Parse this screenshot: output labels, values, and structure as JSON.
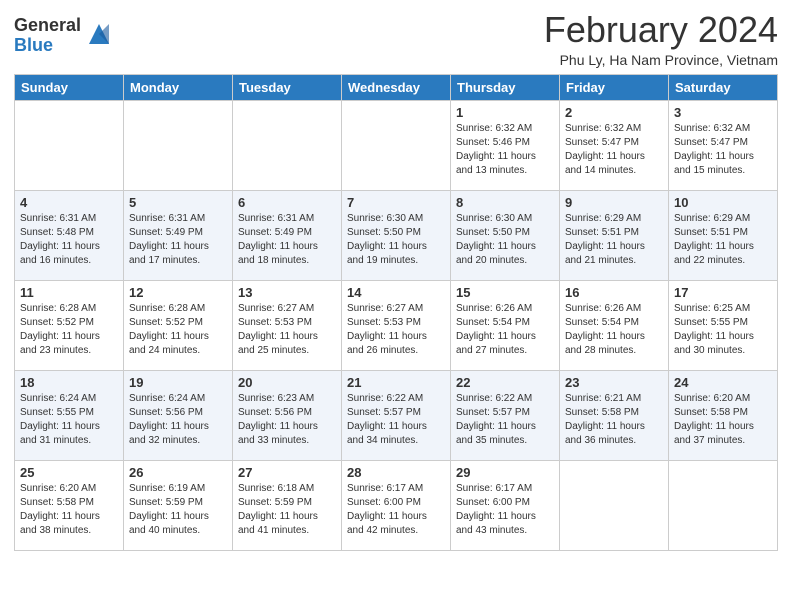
{
  "logo": {
    "general": "General",
    "blue": "Blue"
  },
  "title": "February 2024",
  "subtitle": "Phu Ly, Ha Nam Province, Vietnam",
  "days_of_week": [
    "Sunday",
    "Monday",
    "Tuesday",
    "Wednesday",
    "Thursday",
    "Friday",
    "Saturday"
  ],
  "weeks": [
    [
      {
        "day": "",
        "info": ""
      },
      {
        "day": "",
        "info": ""
      },
      {
        "day": "",
        "info": ""
      },
      {
        "day": "",
        "info": ""
      },
      {
        "day": "1",
        "info": "Sunrise: 6:32 AM\nSunset: 5:46 PM\nDaylight: 11 hours and 13 minutes."
      },
      {
        "day": "2",
        "info": "Sunrise: 6:32 AM\nSunset: 5:47 PM\nDaylight: 11 hours and 14 minutes."
      },
      {
        "day": "3",
        "info": "Sunrise: 6:32 AM\nSunset: 5:47 PM\nDaylight: 11 hours and 15 minutes."
      }
    ],
    [
      {
        "day": "4",
        "info": "Sunrise: 6:31 AM\nSunset: 5:48 PM\nDaylight: 11 hours and 16 minutes."
      },
      {
        "day": "5",
        "info": "Sunrise: 6:31 AM\nSunset: 5:49 PM\nDaylight: 11 hours and 17 minutes."
      },
      {
        "day": "6",
        "info": "Sunrise: 6:31 AM\nSunset: 5:49 PM\nDaylight: 11 hours and 18 minutes."
      },
      {
        "day": "7",
        "info": "Sunrise: 6:30 AM\nSunset: 5:50 PM\nDaylight: 11 hours and 19 minutes."
      },
      {
        "day": "8",
        "info": "Sunrise: 6:30 AM\nSunset: 5:50 PM\nDaylight: 11 hours and 20 minutes."
      },
      {
        "day": "9",
        "info": "Sunrise: 6:29 AM\nSunset: 5:51 PM\nDaylight: 11 hours and 21 minutes."
      },
      {
        "day": "10",
        "info": "Sunrise: 6:29 AM\nSunset: 5:51 PM\nDaylight: 11 hours and 22 minutes."
      }
    ],
    [
      {
        "day": "11",
        "info": "Sunrise: 6:28 AM\nSunset: 5:52 PM\nDaylight: 11 hours and 23 minutes."
      },
      {
        "day": "12",
        "info": "Sunrise: 6:28 AM\nSunset: 5:52 PM\nDaylight: 11 hours and 24 minutes."
      },
      {
        "day": "13",
        "info": "Sunrise: 6:27 AM\nSunset: 5:53 PM\nDaylight: 11 hours and 25 minutes."
      },
      {
        "day": "14",
        "info": "Sunrise: 6:27 AM\nSunset: 5:53 PM\nDaylight: 11 hours and 26 minutes."
      },
      {
        "day": "15",
        "info": "Sunrise: 6:26 AM\nSunset: 5:54 PM\nDaylight: 11 hours and 27 minutes."
      },
      {
        "day": "16",
        "info": "Sunrise: 6:26 AM\nSunset: 5:54 PM\nDaylight: 11 hours and 28 minutes."
      },
      {
        "day": "17",
        "info": "Sunrise: 6:25 AM\nSunset: 5:55 PM\nDaylight: 11 hours and 30 minutes."
      }
    ],
    [
      {
        "day": "18",
        "info": "Sunrise: 6:24 AM\nSunset: 5:55 PM\nDaylight: 11 hours and 31 minutes."
      },
      {
        "day": "19",
        "info": "Sunrise: 6:24 AM\nSunset: 5:56 PM\nDaylight: 11 hours and 32 minutes."
      },
      {
        "day": "20",
        "info": "Sunrise: 6:23 AM\nSunset: 5:56 PM\nDaylight: 11 hours and 33 minutes."
      },
      {
        "day": "21",
        "info": "Sunrise: 6:22 AM\nSunset: 5:57 PM\nDaylight: 11 hours and 34 minutes."
      },
      {
        "day": "22",
        "info": "Sunrise: 6:22 AM\nSunset: 5:57 PM\nDaylight: 11 hours and 35 minutes."
      },
      {
        "day": "23",
        "info": "Sunrise: 6:21 AM\nSunset: 5:58 PM\nDaylight: 11 hours and 36 minutes."
      },
      {
        "day": "24",
        "info": "Sunrise: 6:20 AM\nSunset: 5:58 PM\nDaylight: 11 hours and 37 minutes."
      }
    ],
    [
      {
        "day": "25",
        "info": "Sunrise: 6:20 AM\nSunset: 5:58 PM\nDaylight: 11 hours and 38 minutes."
      },
      {
        "day": "26",
        "info": "Sunrise: 6:19 AM\nSunset: 5:59 PM\nDaylight: 11 hours and 40 minutes."
      },
      {
        "day": "27",
        "info": "Sunrise: 6:18 AM\nSunset: 5:59 PM\nDaylight: 11 hours and 41 minutes."
      },
      {
        "day": "28",
        "info": "Sunrise: 6:17 AM\nSunset: 6:00 PM\nDaylight: 11 hours and 42 minutes."
      },
      {
        "day": "29",
        "info": "Sunrise: 6:17 AM\nSunset: 6:00 PM\nDaylight: 11 hours and 43 minutes."
      },
      {
        "day": "",
        "info": ""
      },
      {
        "day": "",
        "info": ""
      }
    ]
  ]
}
